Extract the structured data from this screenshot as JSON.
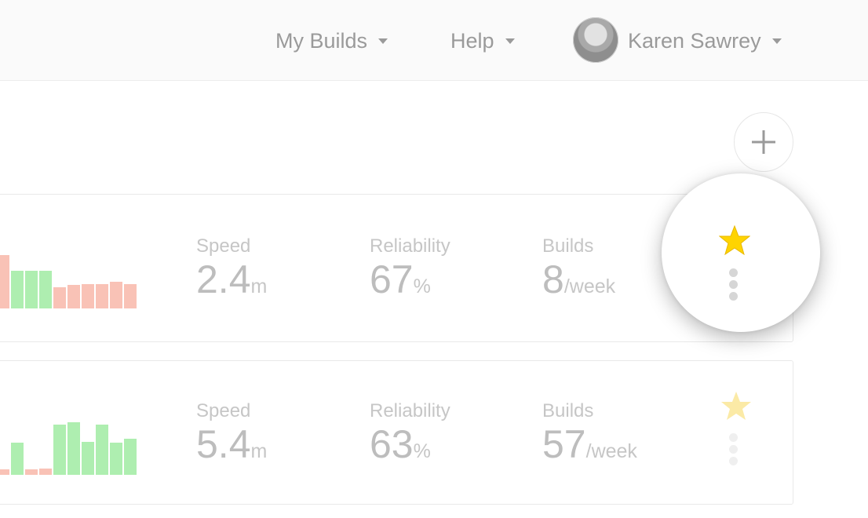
{
  "nav": {
    "my_builds": "My Builds",
    "help": "Help",
    "user_name": "Karen Sawrey"
  },
  "add_button": {
    "icon": "plus-icon"
  },
  "pipelines": [
    {
      "speed": {
        "label": "Speed",
        "value": "2.4",
        "unit": "m"
      },
      "reliability": {
        "label": "Reliability",
        "value": "67",
        "unit": "%"
      },
      "builds": {
        "label": "Builds",
        "value": "8",
        "unit": "/week"
      },
      "starred": true,
      "history": [
        {
          "status": "failed",
          "level": 0.75
        },
        {
          "status": "passed",
          "level": 0.53
        },
        {
          "status": "passed",
          "level": 0.53
        },
        {
          "status": "passed",
          "level": 0.53
        },
        {
          "status": "failed",
          "level": 0.3
        },
        {
          "status": "failed",
          "level": 0.33
        },
        {
          "status": "failed",
          "level": 0.35
        },
        {
          "status": "failed",
          "level": 0.35
        },
        {
          "status": "failed",
          "level": 0.38
        },
        {
          "status": "failed",
          "level": 0.34
        }
      ]
    },
    {
      "speed": {
        "label": "Speed",
        "value": "5.4",
        "unit": "m"
      },
      "reliability": {
        "label": "Reliability",
        "value": "63",
        "unit": "%"
      },
      "builds": {
        "label": "Builds",
        "value": "57",
        "unit": "/week"
      },
      "starred": true,
      "history": [
        {
          "status": "failed",
          "level": 0.08
        },
        {
          "status": "passed",
          "level": 0.46
        },
        {
          "status": "failed",
          "level": 0.08
        },
        {
          "status": "failed",
          "level": 0.09
        },
        {
          "status": "passed",
          "level": 0.71
        },
        {
          "status": "passed",
          "level": 0.74
        },
        {
          "status": "passed",
          "level": 0.47
        },
        {
          "status": "passed",
          "level": 0.71
        },
        {
          "status": "passed",
          "level": 0.46
        },
        {
          "status": "passed",
          "level": 0.51
        }
      ]
    }
  ],
  "colors": {
    "passed": "#aeeeb0",
    "failed": "#f9c2b6",
    "star": "#ffd400",
    "star_faded": "#fbeaa6",
    "text_muted": "#9a9a9a"
  }
}
